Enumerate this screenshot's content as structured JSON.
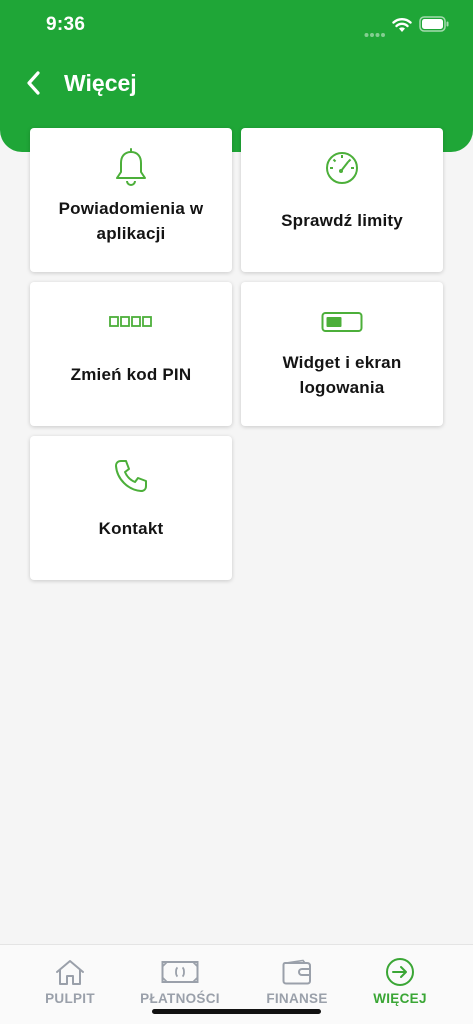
{
  "status_bar": {
    "time": "9:36"
  },
  "header": {
    "title": "Więcej"
  },
  "tiles": [
    {
      "label": "Powiadomienia w aplikacji",
      "icon": "bell-icon"
    },
    {
      "label": "Sprawdź limity",
      "icon": "speedometer-icon"
    },
    {
      "label": "Zmień kod PIN",
      "icon": "pin-code-icon"
    },
    {
      "label": "Widget i ekran logowania",
      "icon": "widget-icon"
    },
    {
      "label": "Kontakt",
      "icon": "phone-icon"
    }
  ],
  "bottom_nav": {
    "items": [
      {
        "label": "PULPIT",
        "icon": "home-icon",
        "active": false
      },
      {
        "label": "PŁATNOŚCI",
        "icon": "payments-icon",
        "active": false
      },
      {
        "label": "FINANSE",
        "icon": "wallet-icon",
        "active": false
      },
      {
        "label": "WIĘCEJ",
        "icon": "arrow-circle-icon",
        "active": true
      }
    ]
  },
  "colors": {
    "brand_green": "#1fa637",
    "icon_green": "#4caf3a",
    "inactive_nav": "#9aa0aa",
    "background": "#f5f5f5"
  }
}
